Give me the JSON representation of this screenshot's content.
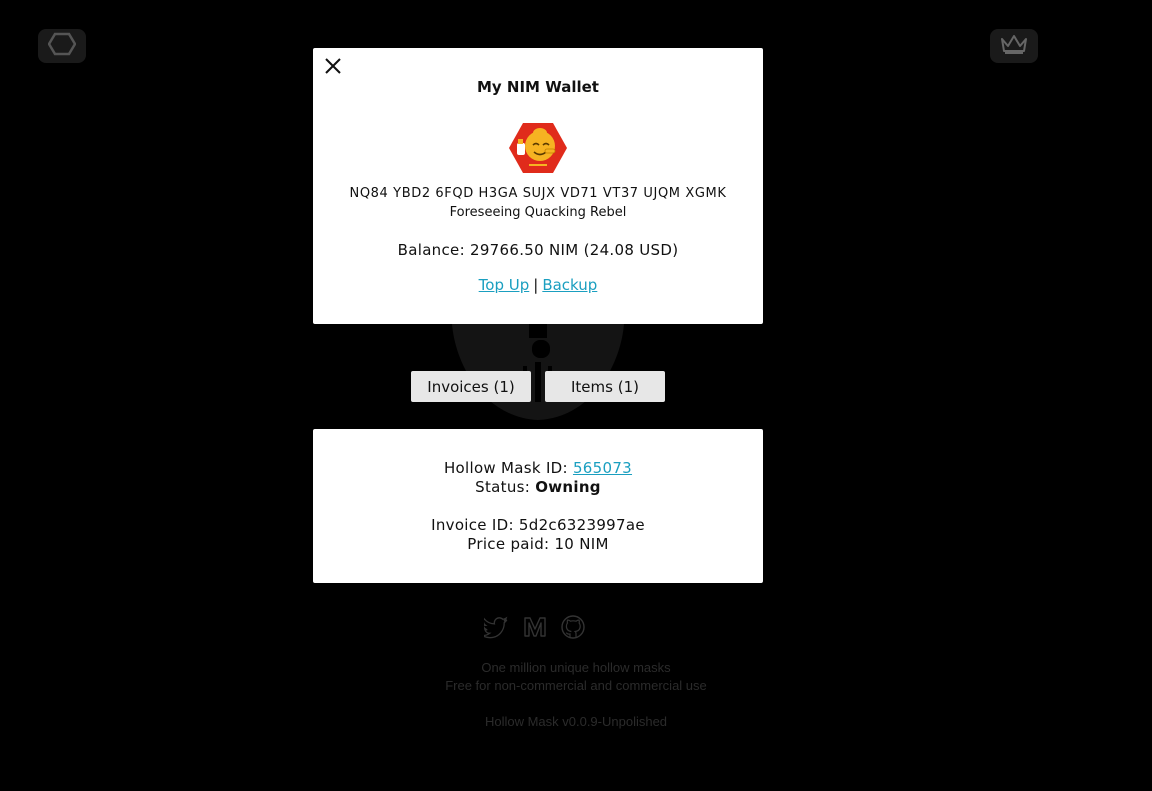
{
  "nav": {
    "home_icon": "hexagon-icon",
    "crown_icon": "crown-icon"
  },
  "wallet": {
    "title": "My NIM Wallet",
    "address": "NQ84 YBD2 6FQD H3GA SUJX VD71 VT37 UJQM XGMK",
    "name": "Foreseeing Quacking Rebel",
    "balance": "Balance: 29766.50 NIM (24.08 USD)",
    "top_up_label": "Top Up",
    "separator": "|",
    "backup_label": "Backup",
    "close_icon": "close-icon",
    "avatar_icon": "nimiq-identicon"
  },
  "tabs": {
    "invoices_label": "Invoices (1)",
    "items_label": "Items (1)"
  },
  "invoice": {
    "mask_id_label": "Hollow Mask ID: ",
    "mask_id_value": "565073",
    "status_label": "Status: ",
    "status_value": "Owning",
    "invoice_id": "Invoice ID: 5d2c6323997ae",
    "price_paid": "Price paid: 10 NIM"
  },
  "socials": {
    "twitter_icon": "twitter-icon",
    "medium_icon": "medium-icon",
    "github_icon": "github-icon"
  },
  "footer": {
    "line1": "One million unique hollow masks",
    "line2": "Free for non-commercial and commercial use",
    "version": "Hollow Mask v0.0.9-Unpolished"
  },
  "colors": {
    "background": "#000000",
    "link": "#1a9fc0",
    "footer_text": "#2b2b2b",
    "card": "#ffffff"
  }
}
